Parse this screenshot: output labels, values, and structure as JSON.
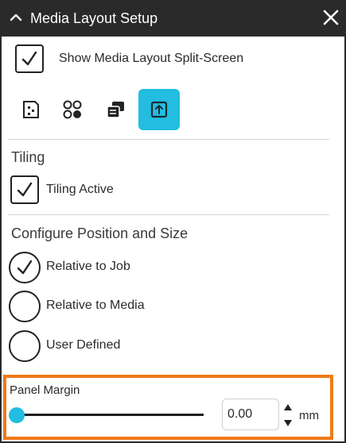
{
  "window": {
    "title": "Media Layout Setup",
    "icons": {
      "collapse": "chevron-up-icon",
      "close": "close-icon"
    }
  },
  "split_screen": {
    "label": "Show Media Layout Split-Screen",
    "checked": true
  },
  "layout_modes": [
    {
      "icon": "page-icon",
      "active": false
    },
    {
      "icon": "grid-circles-icon",
      "active": false
    },
    {
      "icon": "stacked-sheets-icon",
      "active": false
    },
    {
      "icon": "tiling-icon",
      "active": true
    }
  ],
  "tiling": {
    "section_title": "Tiling",
    "active_label": "Tiling Active",
    "checked": true
  },
  "position": {
    "section_title": "Configure Position and Size",
    "options": [
      {
        "label": "Relative to Job",
        "selected": true
      },
      {
        "label": "Relative to Media",
        "selected": false
      },
      {
        "label": "User Defined",
        "selected": false
      }
    ]
  },
  "panel_margin": {
    "label": "Panel Margin",
    "value": "0.00",
    "unit": "mm",
    "slider_fraction": 0.0
  },
  "colors": {
    "accent": "#22bde0",
    "highlight": "#f07a1a",
    "titlebar": "#2a2a2a"
  }
}
